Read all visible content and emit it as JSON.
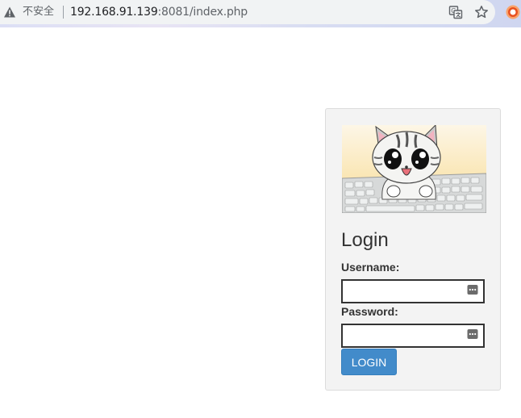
{
  "browser": {
    "security_label": "不安全",
    "url_host": "192.168.91.139",
    "url_rest": ":8081/index.php",
    "icons": [
      "warning-icon",
      "translate-icon",
      "star-icon",
      "extension-icon"
    ]
  },
  "login": {
    "title": "Login",
    "username_label": "Username:",
    "username_value": "",
    "password_label": "Password:",
    "password_value": "",
    "submit_label": "LOGIN"
  },
  "colors": {
    "button": "#428bca",
    "panel": "#f3f3f3"
  }
}
